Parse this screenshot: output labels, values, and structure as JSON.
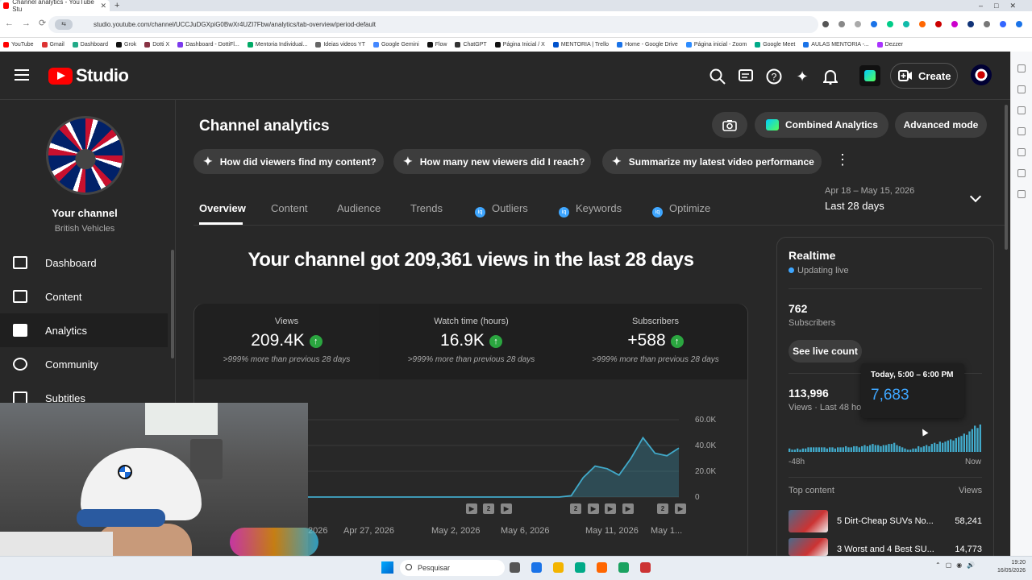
{
  "browser": {
    "tab_title": "Channel analytics - YouTube Stu",
    "url": "studio.youtube.com/channel/UCCJuDGXpiG0BwXr4UZI7Fbw/analytics/tab-overview/period-default",
    "bookmarks": [
      "YouTube",
      "Gmail",
      "Dashboard",
      "Grok",
      "Dotti X",
      "Dashboard - DottiFl...",
      "Mentoria Individual...",
      "Ideias videos YT",
      "Google Gemini",
      "Flow",
      "ChatGPT",
      "Página Inicial / X",
      "MENTORIA | Trello",
      "Home - Google Drive",
      "Página inicial - Zoom",
      "Google Meet",
      "AULAS MENTORIA -...",
      "Dezzer"
    ]
  },
  "header": {
    "logo_text": "Studio",
    "create_label": "Create"
  },
  "sidebar": {
    "channel_name": "Your channel",
    "channel_handle": "British Vehicles",
    "items": [
      {
        "label": "Dashboard"
      },
      {
        "label": "Content"
      },
      {
        "label": "Analytics"
      },
      {
        "label": "Community"
      },
      {
        "label": "Subtitles"
      }
    ]
  },
  "page": {
    "title": "Channel analytics",
    "combined_label": "Combined Analytics",
    "advanced_label": "Advanced mode",
    "chips": [
      "How did viewers find my content?",
      "How many new viewers did I reach?",
      "Summarize my latest video performance"
    ],
    "tabs": [
      "Overview",
      "Content",
      "Audience",
      "Trends",
      "Outliers",
      "Keywords",
      "Optimize"
    ],
    "date_range": "Apr 18 – May 15, 2026",
    "date_label": "Last 28 days",
    "headline": "Your channel got 209,361 views in the last 28 days"
  },
  "metrics": [
    {
      "label": "Views",
      "value": "209.4K",
      "change": ">999% more than previous 28 days"
    },
    {
      "label": "Watch time (hours)",
      "value": "16.9K",
      "change": ">999% more than previous 28 days"
    },
    {
      "label": "Subscribers",
      "value": "+588",
      "change": ">999% more than previous 28 days"
    }
  ],
  "chart_data": {
    "type": "area",
    "title": "",
    "x_ticks": [
      "2026",
      "Apr 27, 2026",
      "May 2, 2026",
      "May 6, 2026",
      "May 11, 2026",
      "May 1..."
    ],
    "y_ticks": [
      "60.0K",
      "40.0K",
      "20.0K",
      "0"
    ],
    "ylim": [
      0,
      60000
    ],
    "color": "#41a9c9",
    "series": [
      {
        "values": [
          0,
          0,
          0,
          0,
          0,
          0,
          0,
          0,
          0,
          0,
          0,
          0,
          0,
          0,
          0,
          0,
          0,
          0,
          0,
          0,
          0,
          0,
          1000,
          15000,
          24000,
          22000,
          17000,
          30000,
          46000,
          34000,
          32000,
          38000
        ]
      }
    ],
    "video_markers": [
      "2",
      "2",
      "2",
      "2",
      "2"
    ]
  },
  "realtime": {
    "title": "Realtime",
    "status": "Updating live",
    "subscribers": "762",
    "subscribers_label": "Subscribers",
    "live_count_label": "See live count",
    "views": "113,996",
    "views_label": "Views · Last 48 hours",
    "range_start": "-48h",
    "range_end": "Now",
    "tooltip_label": "Today, 5:00 – 6:00 PM",
    "tooltip_value": "7,683",
    "bar_values": [
      3,
      2,
      2,
      3,
      2,
      3,
      3,
      4,
      4,
      4,
      4,
      4,
      4,
      4,
      3,
      4,
      4,
      3,
      4,
      4,
      4,
      5,
      4,
      4,
      5,
      5,
      4,
      5,
      6,
      5,
      6,
      7,
      6,
      6,
      5,
      6,
      6,
      7,
      7,
      8,
      6,
      5,
      4,
      3,
      2,
      2,
      3,
      3,
      5,
      4,
      5,
      6,
      5,
      7,
      8,
      7,
      9,
      8,
      9,
      10,
      11,
      10,
      12,
      13,
      14,
      16,
      15,
      18,
      20,
      23,
      21,
      24
    ],
    "top_content_label": "Top content",
    "top_views_label": "Views",
    "top_content": [
      {
        "title": "5 Dirt-Cheap SUVs No...",
        "views": "58,241"
      },
      {
        "title": "3 Worst and 4 Best SU...",
        "views": "14,773"
      }
    ]
  },
  "taskbar": {
    "search_placeholder": "Pesquisar",
    "time": "19:20",
    "date": "16/05/2026"
  }
}
